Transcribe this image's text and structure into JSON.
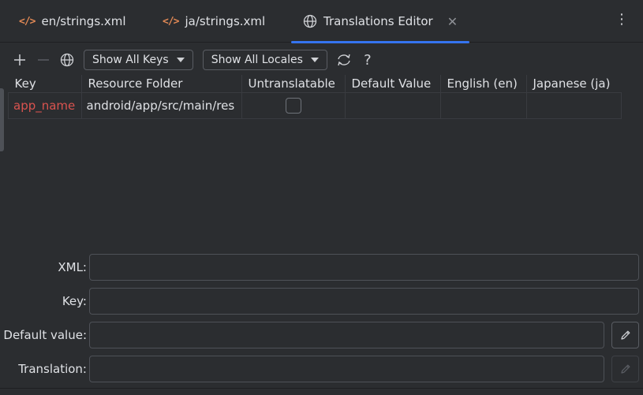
{
  "tabs": [
    {
      "label": "en/strings.xml",
      "icon": "xml-code-icon"
    },
    {
      "label": "ja/strings.xml",
      "icon": "xml-code-icon"
    },
    {
      "label": "Translations Editor",
      "icon": "globe-icon",
      "active": true
    }
  ],
  "toolbar": {
    "keys_filter": "Show All Keys",
    "locales_filter": "Show All Locales",
    "help_label": "?"
  },
  "table": {
    "headers": [
      "Key",
      "Resource Folder",
      "Untranslatable",
      "Default Value",
      "English (en)",
      "Japanese (ja)"
    ],
    "rows": [
      {
        "key": "app_name",
        "resource_folder": "android/app/src/main/res",
        "untranslatable": false,
        "default_value": "",
        "english": "",
        "japanese": ""
      }
    ]
  },
  "form": {
    "xml_label": "XML:",
    "key_label": "Key:",
    "default_value_label": "Default value:",
    "translation_label": "Translation:"
  },
  "colors": {
    "background": "#2b2d30",
    "accent": "#3574f0",
    "key_text": "#d9534f",
    "xml_icon": "#e08855"
  }
}
